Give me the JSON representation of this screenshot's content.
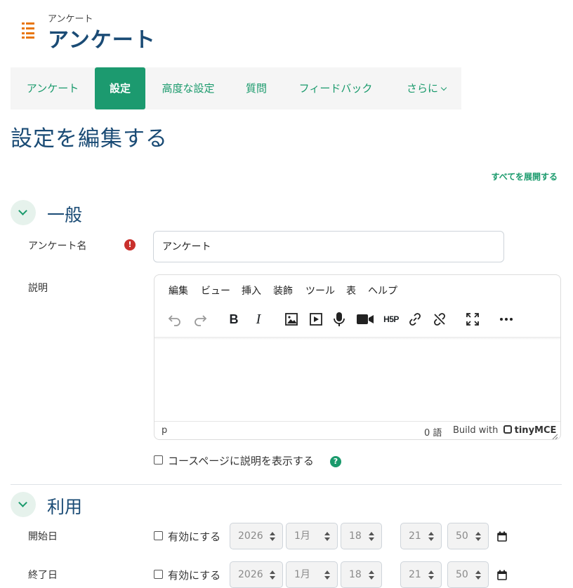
{
  "header": {
    "pretitle": "アンケート",
    "title": "アンケート"
  },
  "tabs": [
    {
      "label": "アンケート",
      "active": false
    },
    {
      "label": "設定",
      "active": true
    },
    {
      "label": "高度な設定",
      "active": false
    },
    {
      "label": "質問",
      "active": false
    },
    {
      "label": "フィードバック",
      "active": false
    },
    {
      "label": "さらに",
      "active": false
    }
  ],
  "page": {
    "heading": "設定を編集する",
    "expand_all": "すべてを展開する"
  },
  "sections": {
    "general": {
      "title": "一般",
      "name_label": "アンケート名",
      "name_value": "アンケート",
      "description_label": "説明",
      "show_description_label": "コースページに説明を表示する"
    },
    "availability": {
      "title": "利用",
      "start_label": "開始日",
      "end_label": "終了日",
      "enable_label": "有効にする"
    }
  },
  "editor": {
    "menu": [
      "編集",
      "ビュー",
      "挿入",
      "装飾",
      "ツール",
      "表",
      "ヘルプ"
    ],
    "status_path": "p",
    "word_count": "0 語",
    "brand_prefix": "Build with",
    "brand_name": "tinyMCE",
    "h5p_label": "H5P"
  },
  "dates": {
    "start": {
      "year": "2026",
      "month": "1月",
      "day": "18",
      "hour": "21",
      "minute": "50"
    },
    "end": {
      "year": "2026",
      "month": "1月",
      "day": "18",
      "hour": "21",
      "minute": "50"
    }
  },
  "colors": {
    "accent": "#1c9a6f",
    "title": "#1a4b75",
    "required": "#c9302c",
    "module_icon": "#e8760a"
  },
  "icons": {
    "module": "list-icon",
    "required": "exclamation-icon",
    "help": "question-icon",
    "calendar": "calendar-icon"
  }
}
